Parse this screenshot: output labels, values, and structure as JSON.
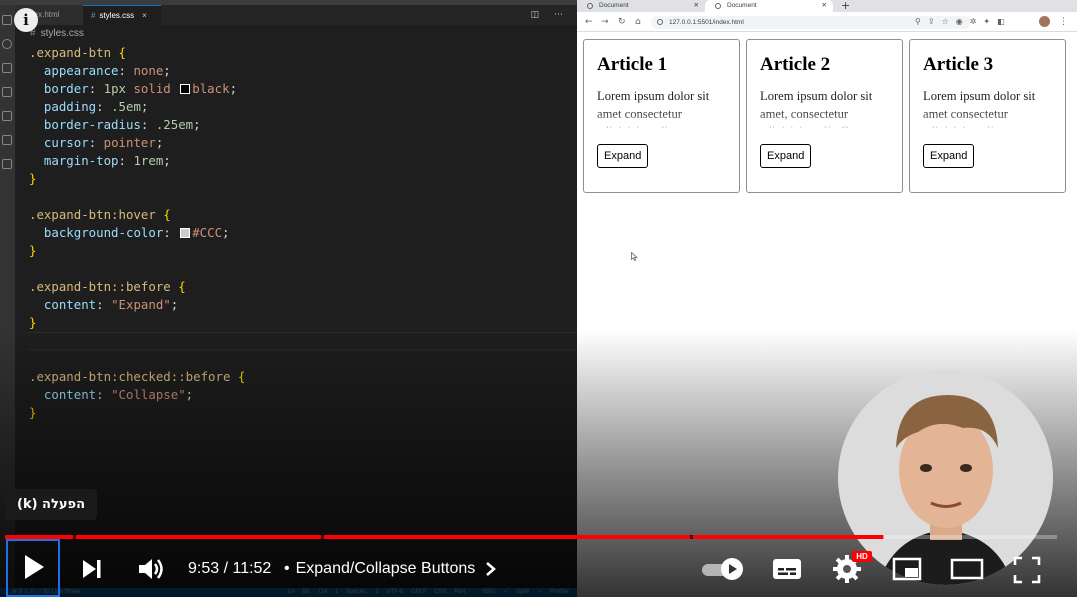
{
  "vscode": {
    "tabs": [
      "index.html",
      "styles.css"
    ],
    "active_tab_close": "×",
    "breadcrumb": "styles.css",
    "code": {
      "block1_selector": ".expand-btn",
      "p_appearance": "appearance",
      "v_appearance": "none",
      "p_border": "border",
      "v_border_num": "1px",
      "v_border_style": "solid",
      "v_border_color": "black",
      "p_padding": "padding",
      "v_padding": ".5em",
      "p_radius": "border-radius",
      "v_radius": ".25em",
      "p_cursor": "cursor",
      "v_cursor": "pointer",
      "p_margin": "margin-top",
      "v_margin": "1rem",
      "block2_selector": ".expand-btn:hover",
      "p_bg": "background-color",
      "v_bg": "#CCC",
      "block3_selector": ".expand-btn::before",
      "p_content": "content",
      "v_content_expand": "\"Expand\"",
      "block4_selector": ".expand-btn:checked::before",
      "v_content_collapse": "\"Collapse\""
    },
    "status_left": "⊗ 0 ⚠ 0 ⓘ 92   Live Share",
    "status_right": "Ln 88, Col 1  Spaces: 2  UTF-8  CRLF  CSS  Port : 5501  ✓ Spell  ✓ Prettier"
  },
  "browser": {
    "tabs": [
      {
        "title": "Document"
      },
      {
        "title": "Document"
      }
    ],
    "new_tab": "+",
    "url": "127.0.0.1:5501/index.html",
    "articles": [
      {
        "title": "Article 1",
        "text": "Lorem ipsum dolor sit amet consectetur adipisicing elit.",
        "button": "Expand"
      },
      {
        "title": "Article 2",
        "text": "Lorem ipsum dolor sit amet, consectetur adipisicing elit. Quas",
        "button": "Expand"
      },
      {
        "title": "Article 3",
        "text": "Lorem ipsum dolor sit amet consectetur adipisicing elit.",
        "button": "Expand"
      }
    ]
  },
  "player": {
    "info_icon": "i",
    "tooltip": "הפעלה (k)",
    "time": "9:53 / 11:52",
    "chapter": "Expand/Collapse Buttons",
    "chapter_separator": "•",
    "hd_badge": "HD",
    "progress_fraction": 0.835,
    "buffer_fraction": 0.835,
    "accent": "#ff0000"
  }
}
